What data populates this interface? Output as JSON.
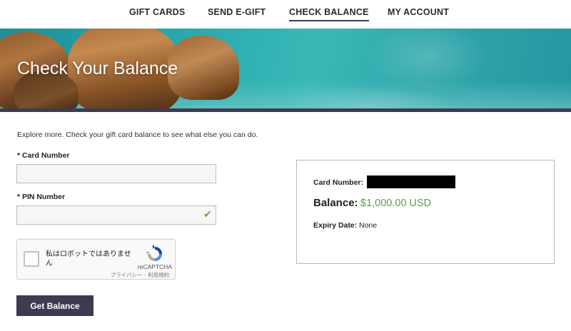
{
  "nav": {
    "items": [
      {
        "label": "GIFT CARDS",
        "active": false
      },
      {
        "label": "SEND E-GIFT",
        "active": false
      },
      {
        "label": "CHECK BALANCE",
        "active": true
      },
      {
        "label": "MY ACCOUNT",
        "active": false
      }
    ]
  },
  "hero": {
    "title": "Check Your Balance"
  },
  "form": {
    "intro": "Explore more. Check your gift card balance to see what else you can do.",
    "card_label": "* Card Number",
    "card_value": "",
    "pin_label": "* PIN Number",
    "pin_value": "",
    "submit_label": "Get Balance"
  },
  "captcha": {
    "text": "私はロボットではありません",
    "brand": "reCAPTCHA",
    "links": "プライバシー - 利用規約"
  },
  "result": {
    "card_label": "Card Number:",
    "balance_label": "Balance:",
    "balance_value": "$1,000.00 USD",
    "expiry_label": "Expiry Date:",
    "expiry_value": "None"
  },
  "colors": {
    "accent": "#3d3b51",
    "balance_green": "#57a142",
    "check_green": "#5bae3a"
  }
}
